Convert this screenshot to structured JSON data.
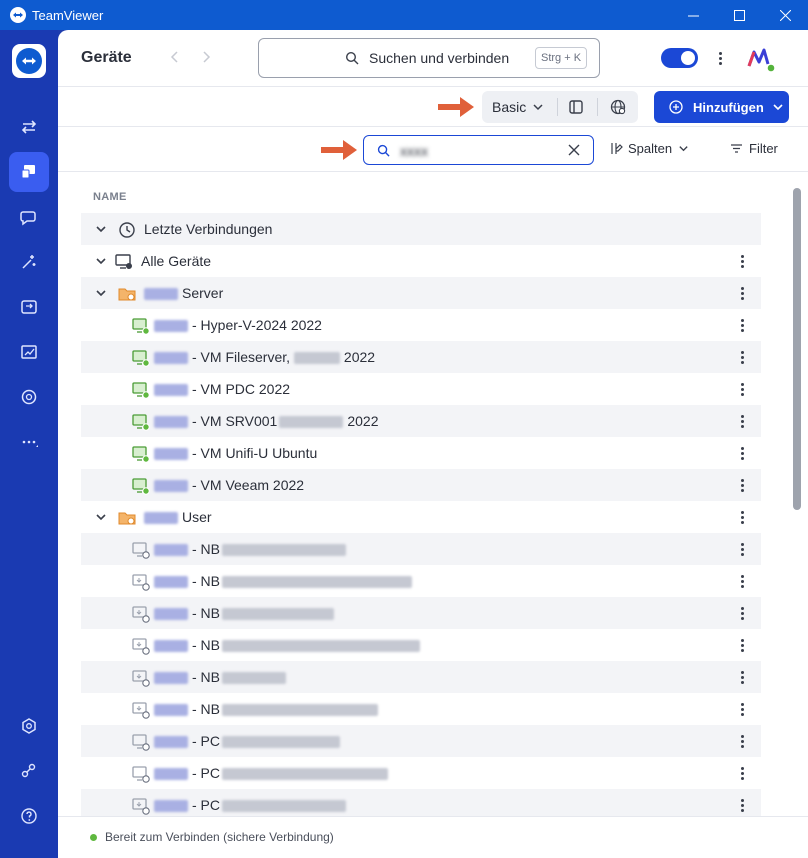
{
  "window": {
    "title": "TeamViewer"
  },
  "header": {
    "title": "Geräte",
    "search_placeholder": "Suchen und verbinden",
    "shortcut": "Strg + K"
  },
  "toolbar": {
    "view_mode": "Basic",
    "add_label": "Hinzufügen"
  },
  "filter": {
    "value": "xxxx",
    "columns_label": "Spalten",
    "filter_label": "Filter"
  },
  "list": {
    "column_header": "NAME",
    "rows": [
      {
        "label": "Letzte Verbindungen"
      },
      {
        "label": "Alle Geräte"
      },
      {
        "label": "Server"
      },
      {
        "label": "- Hyper-V-2024 2022"
      },
      {
        "label": "- VM Fileserver,",
        "suffix": "2022"
      },
      {
        "label": "- VM PDC 2022"
      },
      {
        "label": "- VM SRV001",
        "suffix": "2022"
      },
      {
        "label": "- VM Unifi-U Ubuntu"
      },
      {
        "label": "- VM Veeam 2022"
      },
      {
        "label": "User"
      },
      {
        "label": "- NB"
      },
      {
        "label": "- NB"
      },
      {
        "label": "- NB"
      },
      {
        "label": "- NB"
      },
      {
        "label": "- NB"
      },
      {
        "label": "- NB"
      },
      {
        "label": "- PC"
      },
      {
        "label": "- PC"
      },
      {
        "label": "- PC"
      }
    ]
  },
  "status": {
    "text": "Bereit zum Verbinden (sichere Verbindung)",
    "color": "#5fb83f"
  },
  "colors": {
    "accent": "#1b48d6",
    "rail": "#1a3ab2",
    "titlebar": "#0e5bd0",
    "annotation_arrow": "#e0603a"
  }
}
